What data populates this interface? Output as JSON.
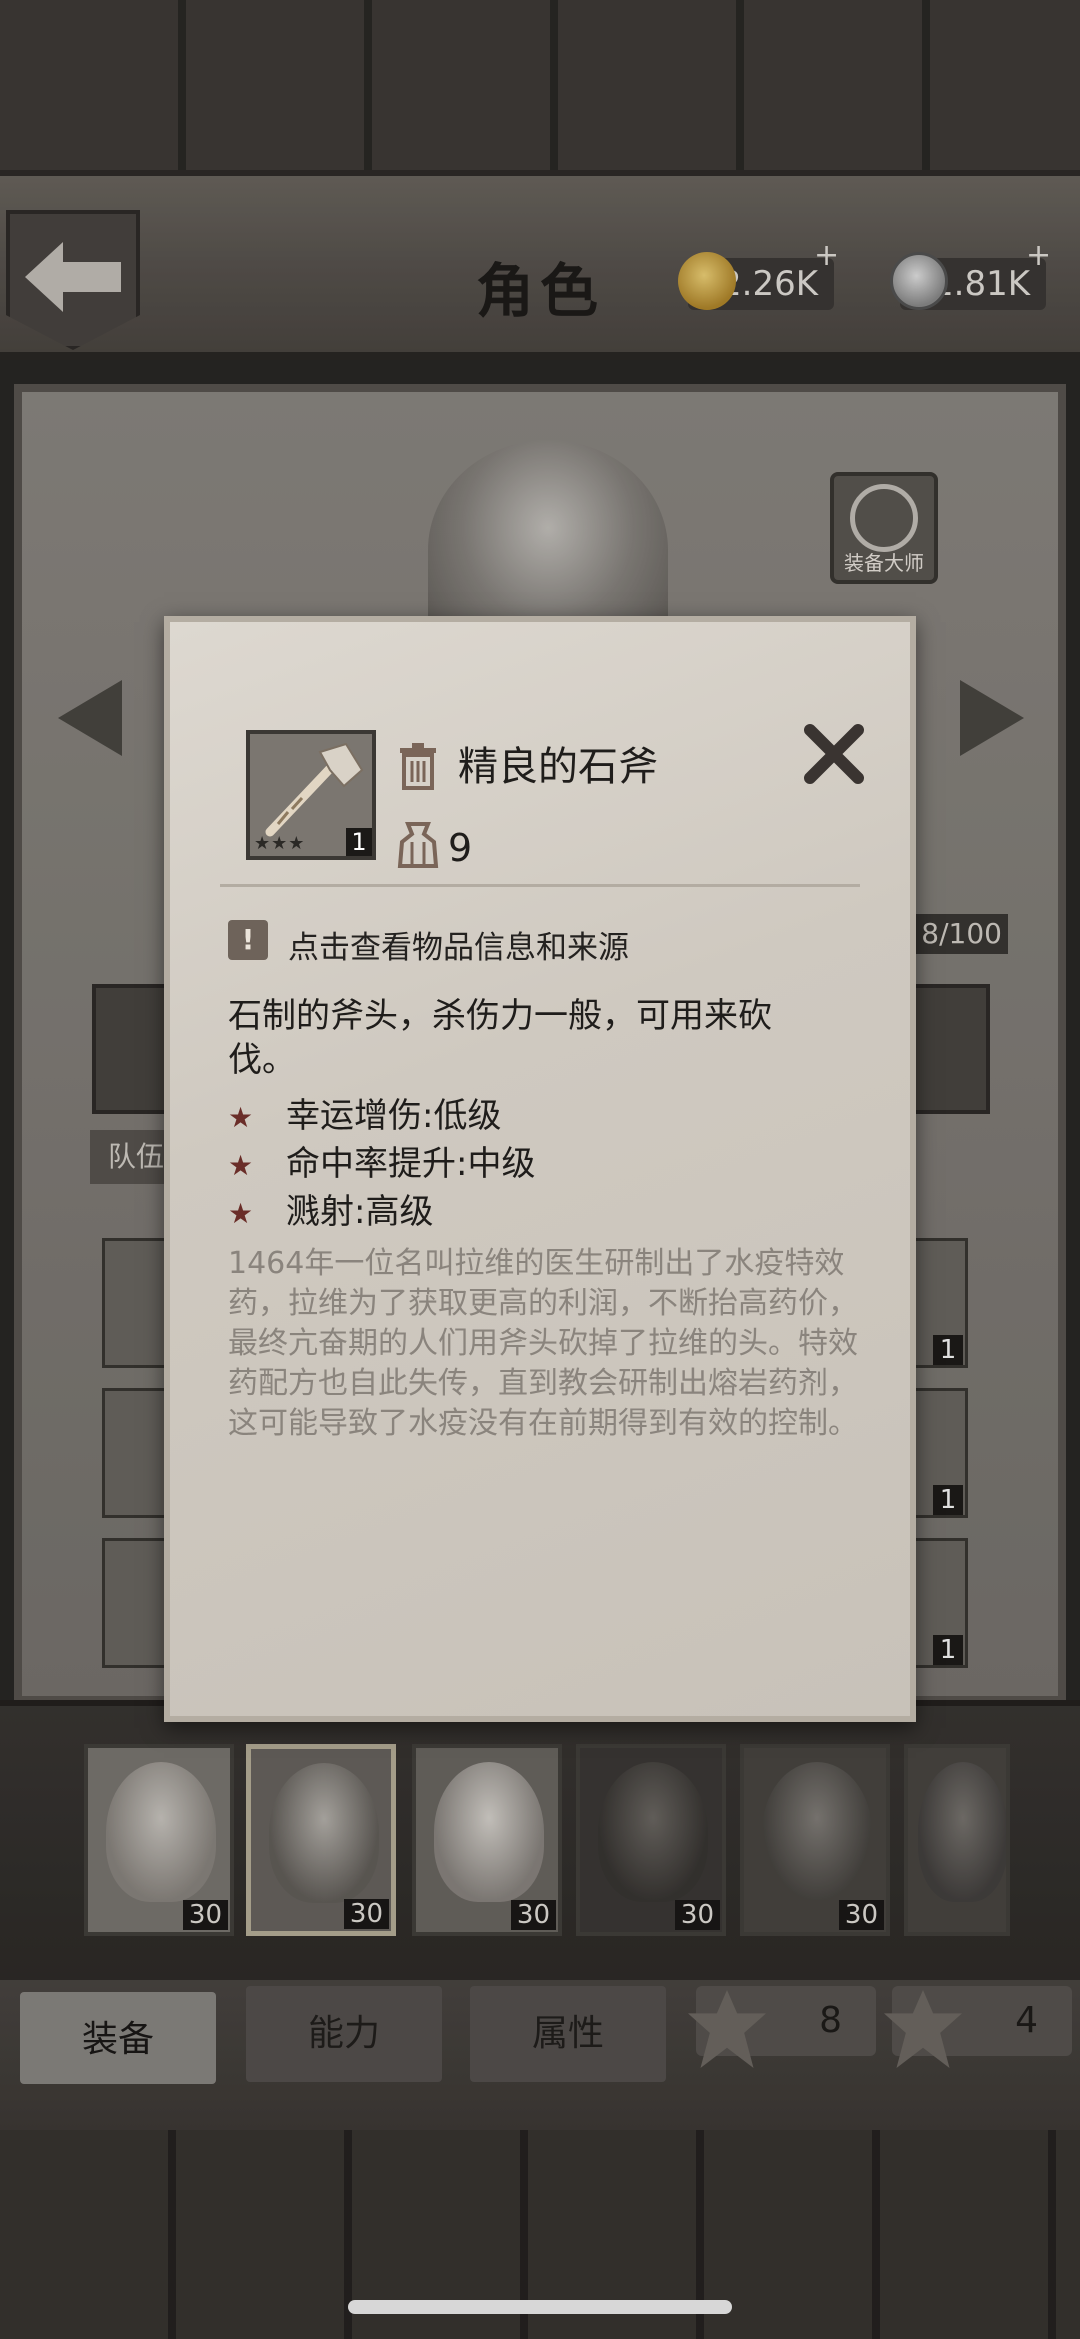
{
  "header": {
    "title": "角色",
    "currencies": [
      {
        "name": "shell",
        "value": "2.26K",
        "plus": "+"
      },
      {
        "name": "coin",
        "value": "1.81K",
        "plus": "+"
      }
    ],
    "master_equip_label": "装备大师"
  },
  "inventory": {
    "capacity": "8/100",
    "team_tab": "队伍",
    "right_counts": [
      "1",
      "1",
      "1"
    ]
  },
  "item_popup": {
    "name": "精良的石斧",
    "weight": "9",
    "stack_count": "1",
    "stars": "★★★",
    "info_hint": "点击查看物品信息和来源",
    "description": "石制的斧头，杀伤力一般，可用来砍伐。",
    "attributes": [
      {
        "label": "幸运增伤:低级"
      },
      {
        "label": "命中率提升:中级"
      },
      {
        "label": "溅射:高级"
      }
    ],
    "lore": "1464年一位名叫拉维的医生研制出了水疫特效药，拉维为了获取更高的利润，不断抬高药价，最终亢奋期的人们用斧头砍掉了拉维的头。特效药配方也自此失传，直到教会研制出熔岩药剂，这可能导致了水疫没有在前期得到有效的控制。"
  },
  "characters": [
    {
      "level": "30"
    },
    {
      "level": "30"
    },
    {
      "level": "30"
    },
    {
      "level": "30"
    },
    {
      "level": "30"
    },
    {
      "level": ""
    }
  ],
  "bottom_tabs": {
    "equip": "装备",
    "ability": "能力",
    "attributes": "属性",
    "badge_1": "8",
    "badge_2": "4"
  }
}
